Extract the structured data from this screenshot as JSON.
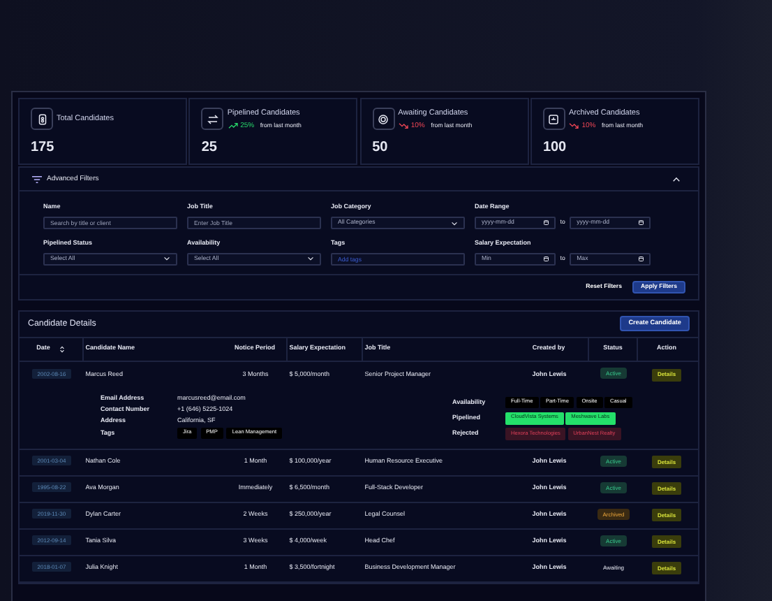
{
  "stats": [
    {
      "label": "Total Candidates",
      "value": "175"
    },
    {
      "label": "Pipelined Candidates",
      "value": "25",
      "trend": {
        "kind": "up",
        "percent": "25%",
        "note": "from last month"
      }
    },
    {
      "label": "Awaiting Candidates",
      "value": "50",
      "trend": {
        "kind": "down",
        "percent": "10%",
        "note": "from last month"
      }
    },
    {
      "label": "Archived Candidates",
      "value": "100",
      "trend": {
        "kind": "down",
        "percent": "10%",
        "note": "from last month"
      }
    }
  ],
  "filters": {
    "title": "Advanced Filters",
    "expanded": true,
    "fields": [
      {
        "kind": "text",
        "label": "Name",
        "placeholder": "Search by title or client"
      },
      {
        "kind": "text",
        "label": "Job Title",
        "placeholder": "Enter Job Title"
      },
      {
        "kind": "select",
        "label": "Job Category",
        "value": "All Categories"
      },
      {
        "kind": "range",
        "label": "Date Range",
        "from": "yyyy-mm-dd",
        "sep": "to",
        "to": "yyyy-mm-dd"
      },
      {
        "kind": "select",
        "label": "Pipelined Status",
        "value": "Select All"
      },
      {
        "kind": "select",
        "label": "Availability",
        "value": "Select All"
      },
      {
        "kind": "tags",
        "label": "Tags",
        "placeholder": "Add tags"
      },
      {
        "kind": "range",
        "label": "Salary Expectation",
        "from": "Min",
        "sep": "to",
        "to": "Max"
      }
    ],
    "reset": "Reset Filters",
    "apply": "Apply Filters"
  },
  "details": {
    "title": "Candidate Details",
    "create": "Create Candidate",
    "columns": [
      "Date",
      "Candidate Name",
      "Notice Period",
      "Salary Expectation",
      "Job Title",
      "Created by",
      "Status",
      "Action"
    ],
    "rows": [
      {
        "date": "2002-08-16",
        "name": "Marcus Reed",
        "notice": "3 Months",
        "salary": "$ 5,000/month",
        "job": "Senior Project Manager",
        "created_by": "John Lewis",
        "status": "Active",
        "kind": "active",
        "action": "Details",
        "expanded": true,
        "info": [
          {
            "label": "Email Address",
            "value": "marcusreed@email.com"
          },
          {
            "label": "Contact Number",
            "value": "+1 (646) 5225-1024"
          },
          {
            "label": "Address",
            "value": "California, SF"
          }
        ],
        "tags_label": "Tags",
        "tags": [
          "Jira",
          "PMP",
          "Lean Management"
        ],
        "groups": [
          {
            "label": "Availability",
            "kind": "plain",
            "chips": [
              "Full-Time",
              "Part-Time",
              "Onsite",
              "Casual"
            ]
          },
          {
            "label": "Pipelined",
            "kind": "good",
            "chips": [
              "CloudVista Systems",
              "Meshwave Labs"
            ]
          },
          {
            "label": "Rejected",
            "kind": "bad",
            "chips": [
              "Hexora Technologies",
              "UrbanNest Realty"
            ]
          }
        ]
      },
      {
        "date": "2001-03-04",
        "name": "Nathan Cole",
        "notice": "1 Month",
        "salary": "$ 100,000/year",
        "job": "Human Resource Executive",
        "created_by": "John Lewis",
        "status": "Active",
        "kind": "active",
        "action": "Details",
        "expanded": false
      },
      {
        "date": "1995-08-22",
        "name": "Ava Morgan",
        "notice": "Immediately",
        "salary": "$ 6,500/month",
        "job": "Full-Stack Developer",
        "created_by": "John Lewis",
        "status": "Active",
        "kind": "active",
        "action": "Details",
        "expanded": false
      },
      {
        "date": "2019-11-30",
        "name": "Dylan Carter",
        "notice": "2 Weeks",
        "salary": "$ 250,000/year",
        "job": "Legal Counsel",
        "created_by": "John Lewis",
        "status": "Archived",
        "kind": "archived",
        "action": "Details",
        "expanded": false
      },
      {
        "date": "2012-09-14",
        "name": "Tania Silva",
        "notice": "3 Weeks",
        "salary": "$ 4,000/week",
        "job": "Head Chef",
        "created_by": "John Lewis",
        "status": "Active",
        "kind": "active",
        "action": "Details",
        "expanded": false
      },
      {
        "date": "2018-01-07",
        "name": "Julia Knight",
        "notice": "1 Month",
        "salary": "$ 3,500/fortnight",
        "job": "Business Development Manager",
        "created_by": "John Lewis",
        "status": "Awaiting",
        "kind": "awaiting",
        "action": "Details",
        "expanded": false
      }
    ]
  }
}
